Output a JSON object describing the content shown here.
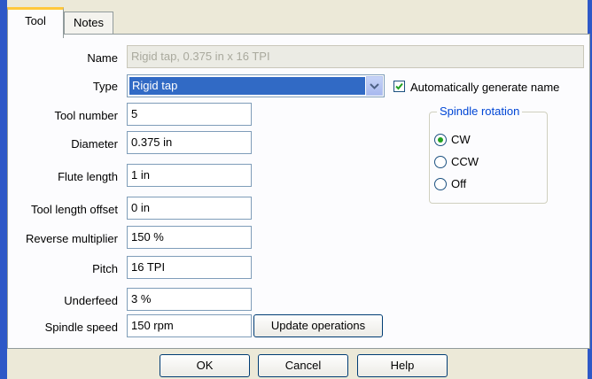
{
  "tabs": {
    "tool": "Tool",
    "notes": "Notes"
  },
  "form": {
    "name": {
      "label": "Name",
      "value": "Rigid tap, 0.375 in x 16 TPI"
    },
    "type": {
      "label": "Type",
      "value": "Rigid tap"
    },
    "auto_name": {
      "label": "Automatically generate name",
      "checked": true
    },
    "tool_number": {
      "label": "Tool number",
      "value": "5"
    },
    "diameter": {
      "label": "Diameter",
      "value": "0.375 in"
    },
    "flute_length": {
      "label": "Flute length",
      "value": "1 in"
    },
    "tool_length_offset": {
      "label": "Tool length offset",
      "value": "0 in"
    },
    "reverse_multiplier": {
      "label": "Reverse multiplier",
      "value": "150 %"
    },
    "pitch": {
      "label": "Pitch",
      "value": "16 TPI"
    },
    "underfeed": {
      "label": "Underfeed",
      "value": "3 %"
    },
    "spindle_speed": {
      "label": "Spindle speed",
      "value": "150 rpm"
    }
  },
  "spindle_rotation": {
    "title": "Spindle rotation",
    "options": [
      "CW",
      "CCW",
      "Off"
    ],
    "selected": "CW"
  },
  "buttons": {
    "update_operations": "Update operations",
    "ok": "OK",
    "cancel": "Cancel",
    "help": "Help"
  },
  "colors": {
    "accent": "#316ac5",
    "frame": "#2e58c7",
    "tab_highlight": "#ffc83c",
    "radio_dot": "#21a121",
    "check": "#21a121"
  }
}
